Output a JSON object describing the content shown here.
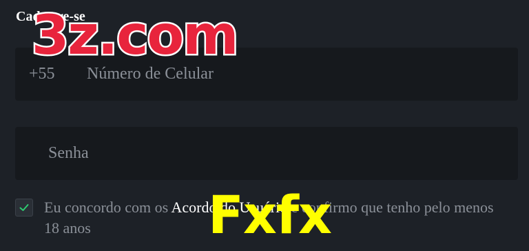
{
  "form": {
    "title": "Cadastre-se",
    "phone": {
      "prefix": "+55",
      "placeholder": "Número de Celular"
    },
    "password": {
      "placeholder": "Senha"
    },
    "agreement": {
      "checked": true,
      "text_before": "Eu concordo com os ",
      "link_text": "Acordo do Usuário",
      "text_after": " e confirmo que tenho pelo menos 18 anos"
    }
  },
  "overlays": {
    "brand_text": "3z.com",
    "watermark_text": "Fxfx"
  },
  "colors": {
    "background": "#1d2127",
    "field_background": "#16191d",
    "check_green": "#2ecc71",
    "brand_red": "#e8243c",
    "watermark_yellow": "#ffff00"
  },
  "icons": {
    "checkbox": "checkmark-icon"
  }
}
